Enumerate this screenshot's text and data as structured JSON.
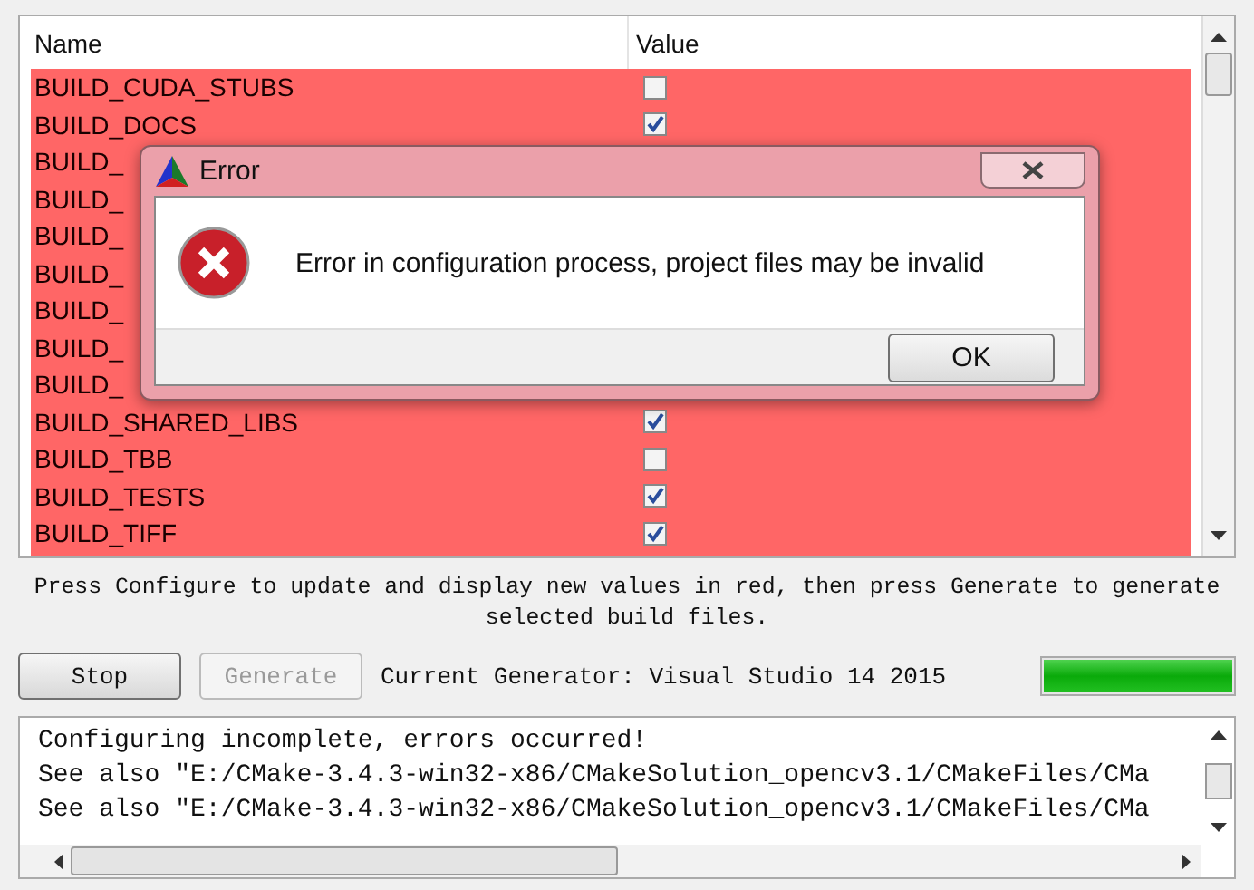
{
  "table": {
    "columns": [
      "Name",
      "Value"
    ],
    "rows": [
      {
        "name": "BUILD_CUDA_STUBS",
        "checked": false
      },
      {
        "name": "BUILD_DOCS",
        "checked": true
      },
      {
        "name": "BUILD_"
      },
      {
        "name": "BUILD_"
      },
      {
        "name": "BUILD_"
      },
      {
        "name": "BUILD_"
      },
      {
        "name": "BUILD_"
      },
      {
        "name": "BUILD_"
      },
      {
        "name": "BUILD_"
      },
      {
        "name": "BUILD_SHARED_LIBS",
        "checked": true
      },
      {
        "name": "BUILD_TBB",
        "checked": false
      },
      {
        "name": "BUILD_TESTS",
        "checked": true
      },
      {
        "name": "BUILD_TIFF",
        "checked": true
      }
    ]
  },
  "hint": "Press Configure to update and display new values in red, then press Generate to generate selected build files.",
  "buttons": [
    {
      "label": "Stop",
      "disabled": false
    },
    {
      "label": "Generate",
      "disabled": true
    }
  ],
  "generator": "Current Generator: Visual Studio 14 2015",
  "progress": {
    "level": 1
  },
  "log": [
    "Configuring incomplete, errors occurred!",
    "See also \"E:/CMake-3.4.3-win32-x86/CMakeSolution_opencv3.1/CMakeFiles/CMa",
    "See also \"E:/CMake-3.4.3-win32-x86/CMakeSolution_opencv3.1/CMakeFiles/CMa"
  ],
  "dialog": {
    "title": "Error",
    "message": "Error in configuration process, project files may be invalid",
    "button": "OK"
  }
}
